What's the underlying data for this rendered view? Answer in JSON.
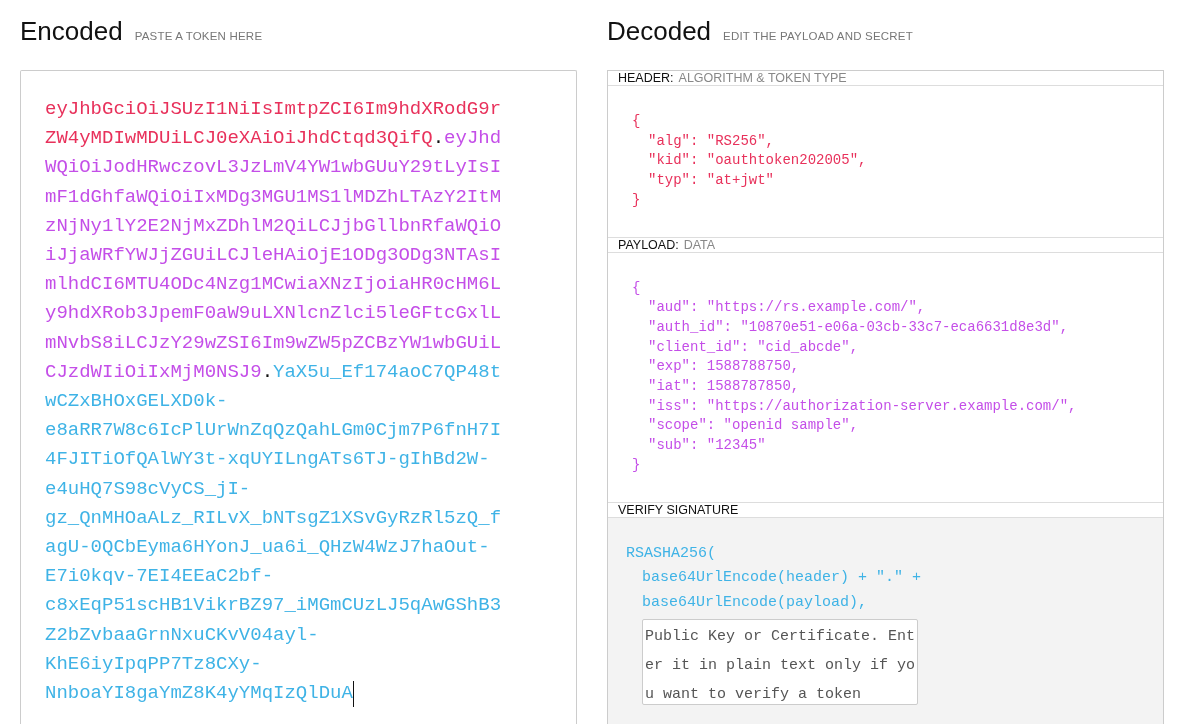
{
  "encoded": {
    "title": "Encoded",
    "subtitle": "PASTE A TOKEN HERE",
    "lines": [
      [
        {
          "kind": "header",
          "text": "eyJhbGciOiJSUzI1NiIsImtpZCI6Im9hdXRodG9r"
        }
      ],
      [
        {
          "kind": "header",
          "text": "ZW4yMDIwMDUiLCJ0eXAiOiJhdCtqd3QifQ"
        },
        {
          "kind": "dot",
          "text": "."
        },
        {
          "kind": "payload",
          "text": "eyJhd"
        }
      ],
      [
        {
          "kind": "payload",
          "text": "WQiOiJodHRwczovL3JzLmV4YW1wbGUuY29tLyIsI"
        }
      ],
      [
        {
          "kind": "payload",
          "text": "mF1dGhfaWQiOiIxMDg3MGU1MS1lMDZhLTAzY2ItM"
        }
      ],
      [
        {
          "kind": "payload",
          "text": "zNjNy1lY2E2NjMxZDhlM2QiLCJjbGllbnRfaWQiO"
        }
      ],
      [
        {
          "kind": "payload",
          "text": "iJjaWRfYWJjZGUiLCJleHAiOjE1ODg3ODg3NTAsI"
        }
      ],
      [
        {
          "kind": "payload",
          "text": "mlhdCI6MTU4ODc4Nzg1MCwiaXNzIjoiaHR0cHM6L"
        }
      ],
      [
        {
          "kind": "payload",
          "text": "y9hdXRob3JpemF0aW9uLXNlcnZlci5leGFtcGxlL"
        }
      ],
      [
        {
          "kind": "payload",
          "text": "mNvbS8iLCJzY29wZSI6Im9wZW5pZCBzYW1wbGUiL"
        }
      ],
      [
        {
          "kind": "payload",
          "text": "CJzdWIiOiIxMjM0NSJ9"
        },
        {
          "kind": "dot",
          "text": "."
        },
        {
          "kind": "signature",
          "text": "YaX5u_Ef174aoC7QP48t"
        }
      ],
      [
        {
          "kind": "signature",
          "text": "wCZxBHOxGELXD0k-"
        }
      ],
      [
        {
          "kind": "signature",
          "text": "e8aRR7W8c6IcPlUrWnZqQzQahLGm0Cjm7P6fnH7I"
        }
      ],
      [
        {
          "kind": "signature",
          "text": "4FJITiOfQAlWY3t-xqUYILngATs6TJ-gIhBd2W-"
        }
      ],
      [
        {
          "kind": "signature",
          "text": "e4uHQ7S98cVyCS_jI-"
        }
      ],
      [
        {
          "kind": "signature",
          "text": "gz_QnMHOaALz_RILvX_bNTsgZ1XSvGyRzRl5zQ_f"
        }
      ],
      [
        {
          "kind": "signature",
          "text": "agU-0QCbEyma6HYonJ_ua6i_QHzW4WzJ7haOut-"
        }
      ],
      [
        {
          "kind": "signature",
          "text": "E7i0kqv-7EI4EEaC2bf-"
        }
      ],
      [
        {
          "kind": "signature",
          "text": "c8xEqP51scHB1VikrBZ97_iMGmCUzLJ5qAwGShB3"
        }
      ],
      [
        {
          "kind": "signature",
          "text": "Z2bZvbaaGrnNxuCKvV04ayl-"
        }
      ],
      [
        {
          "kind": "signature",
          "text": "KhE6iyIpqPP7Tz8CXy-"
        }
      ],
      [
        {
          "kind": "signature",
          "text": "NnboaYI8gaYmZ8K4yYMqIzQlDuA"
        }
      ]
    ]
  },
  "decoded": {
    "title": "Decoded",
    "subtitle": "EDIT THE PAYLOAD AND SECRET",
    "sections": [
      {
        "kind": "json",
        "label": "HEADER:",
        "sublabel": "ALGORITHM & TOKEN TYPE",
        "color": "#e8315b",
        "open": "{",
        "entries": [
          "\"alg\": \"RS256\",",
          "\"kid\": \"oauthtoken202005\",",
          "\"typ\": \"at+jwt\""
        ],
        "close": "}"
      },
      {
        "kind": "json",
        "label": "PAYLOAD:",
        "sublabel": "DATA",
        "color": "#c44ee8",
        "open": "{",
        "entries": [
          "\"aud\": \"https://rs.example.com/\",",
          "\"auth_id\": \"10870e51-e06a-03cb-33c7-eca6631d8e3d\",",
          "\"client_id\": \"cid_abcde\",",
          "\"exp\": 1588788750,",
          "\"iat\": 1588787850,",
          "\"iss\": \"https://authorization-server.example.com/\",",
          "\"scope\": \"openid sample\",",
          "\"sub\": \"12345\""
        ],
        "close": "}"
      },
      {
        "kind": "verify",
        "label": "VERIFY SIGNATURE",
        "color": "#3fb3e6",
        "call": "RSASHA256(",
        "args": [
          "base64UrlEncode(header) + \".\" +",
          "base64UrlEncode(payload),"
        ],
        "key_field": {
          "placeholder": "Public Key or Certificate. Enter it in plain text only if you want to verify a token"
        }
      }
    ]
  }
}
